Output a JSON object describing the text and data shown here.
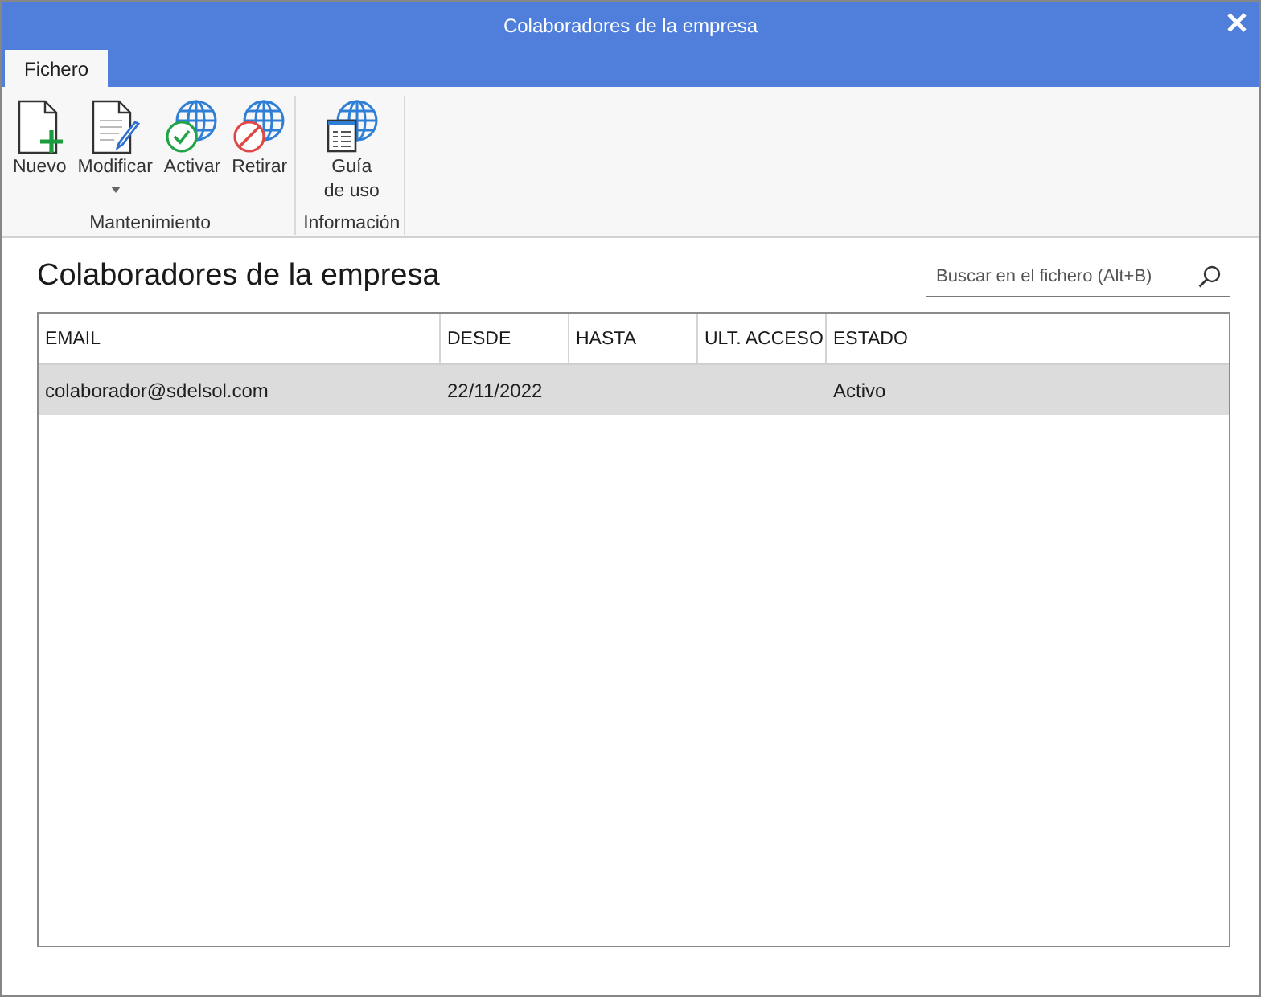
{
  "window": {
    "title": "Colaboradores de la empresa"
  },
  "tabs": [
    {
      "label": "Fichero",
      "selected": true
    }
  ],
  "ribbon": {
    "groups": [
      {
        "label": "Mantenimiento",
        "buttons": [
          {
            "kind": "new",
            "label": "Nuevo"
          },
          {
            "kind": "edit",
            "label": "Modificar",
            "dropdown": true
          },
          {
            "kind": "activate",
            "label": "Activar"
          },
          {
            "kind": "retire",
            "label": "Retirar"
          }
        ]
      },
      {
        "label": "Información",
        "buttons": [
          {
            "kind": "guide",
            "label": "Guía de uso"
          }
        ]
      }
    ]
  },
  "heading": "Colaboradores de la empresa",
  "search": {
    "placeholder": "Buscar en el fichero (Alt+B)"
  },
  "table": {
    "columns": [
      "EMAIL",
      "DESDE",
      "HASTA",
      "ULT. ACCESO",
      "ESTADO"
    ],
    "rows": [
      {
        "selected": true,
        "cells": [
          "colaborador@sdelsol.com",
          "22/11/2022",
          null,
          null,
          "Activo"
        ]
      }
    ]
  }
}
